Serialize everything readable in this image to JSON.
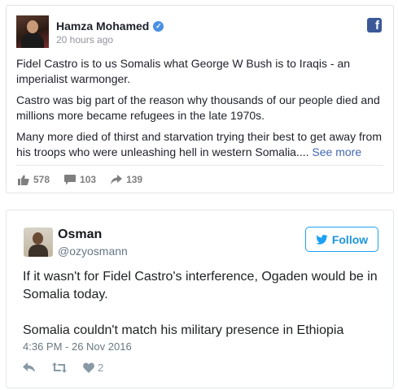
{
  "facebook_post": {
    "author": "Hamza Mohamed",
    "timestamp": "20 hours ago",
    "paragraphs": [
      "Fidel Castro is to us Somalis what George W Bush is to Iraqis - an imperialist warmonger.",
      "Castro was big part of the reason why thousands of our people died and millions more became refugees in the late 1970s.",
      "Many more died of thirst and starvation trying their best to get away from his troops who were unleashing hell in western Somalia...."
    ],
    "see_more": "See more",
    "stats": {
      "likes": "578",
      "comments": "103",
      "shares": "139"
    },
    "icons": [
      "verified-badge-icon",
      "facebook-logo-icon",
      "like-icon",
      "comment-icon",
      "share-icon"
    ]
  },
  "tweet": {
    "author": "Osman",
    "handle": "@ozyosmann",
    "follow_label": "Follow",
    "paragraphs": [
      "If it wasn't for Fidel Castro's interference, Ogaden would be in Somalia today.",
      "Somalia couldn't match his military presence in Ethiopia"
    ],
    "datetime": "4:36 PM - 26 Nov 2016",
    "likes": "2",
    "icons": [
      "twitter-bird-icon",
      "reply-icon",
      "retweet-icon",
      "heart-icon"
    ]
  },
  "colors": {
    "facebook_blue": "#3b5998",
    "link_blue": "#4267b2",
    "twitter_blue": "#1da1f2",
    "muted_text": "#90949c"
  }
}
